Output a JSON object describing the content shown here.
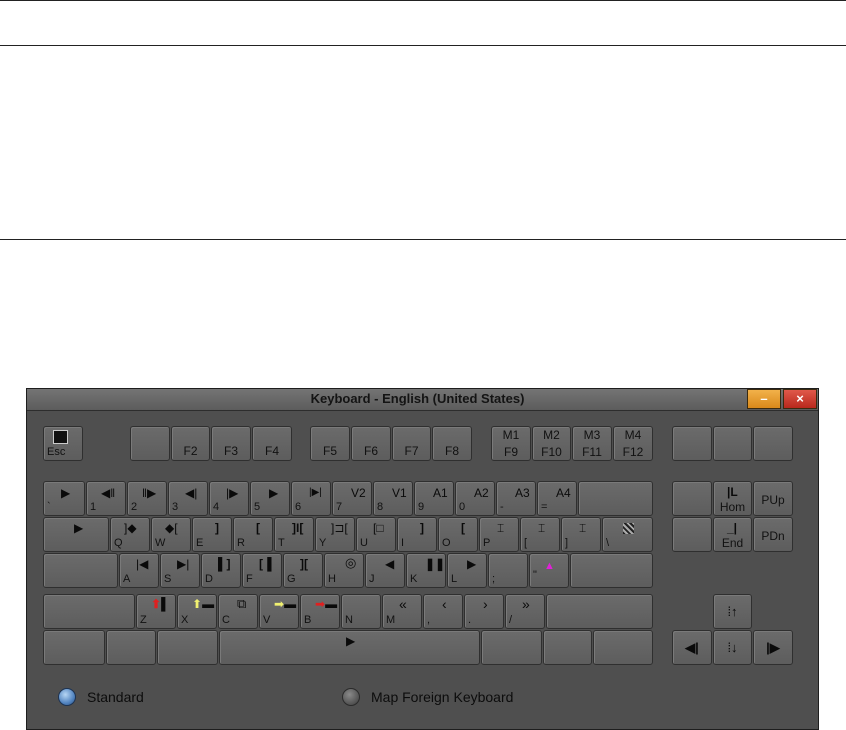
{
  "window": {
    "title": "Keyboard - English (United States)",
    "minimize_label": "–",
    "close_label": "×"
  },
  "keys": {
    "esc": "Esc",
    "f2": "F2",
    "f3": "F3",
    "f4": "F4",
    "f5": "F5",
    "f6": "F6",
    "f7": "F7",
    "f8": "F8",
    "m1": "M1",
    "m2": "M2",
    "m3": "M3",
    "m4": "M4",
    "f9": "F9",
    "f10": "F10",
    "f11": "F11",
    "f12": "F12",
    "grave": "`",
    "n1": "1",
    "n2": "2",
    "n3": "3",
    "n4": "4",
    "n5": "5",
    "n6": "6",
    "n7": "7",
    "n8": "8",
    "n9": "9",
    "n0": "0",
    "minus": "-",
    "equals": "=",
    "v2": "V2",
    "v1": "V1",
    "a1": "A1",
    "a2": "A2",
    "a3": "A3",
    "a4": "A4",
    "q": "Q",
    "w": "W",
    "e": "E",
    "r": "R",
    "t": "T",
    "y": "Y",
    "u": "U",
    "i": "I",
    "o": "O",
    "p": "P",
    "lbracket": "[",
    "rbracket": "]",
    "backslash": "\\",
    "a": "A",
    "s": "S",
    "d": "D",
    "f": "F",
    "g": "G",
    "h": "H",
    "j": "J",
    "k": "K",
    "l": "L",
    "semicolon": ";",
    "quote": "\"",
    "z": "Z",
    "x": "X",
    "c": "C",
    "v": "V",
    "b": "B",
    "n": "N",
    "m": "M",
    "comma": ",",
    "period": ".",
    "slash": "/",
    "hom": "Hom",
    "pup": "PUp",
    "end": "End",
    "pdn": "PDn"
  },
  "options": {
    "standard": "Standard",
    "map_foreign": "Map Foreign Keyboard",
    "selected": "Standard"
  },
  "colors": {
    "window_bg": "#4f4f4f",
    "minimize": "#e8a030",
    "close": "#c8392c",
    "radio_selected": "#5a8ccc"
  }
}
